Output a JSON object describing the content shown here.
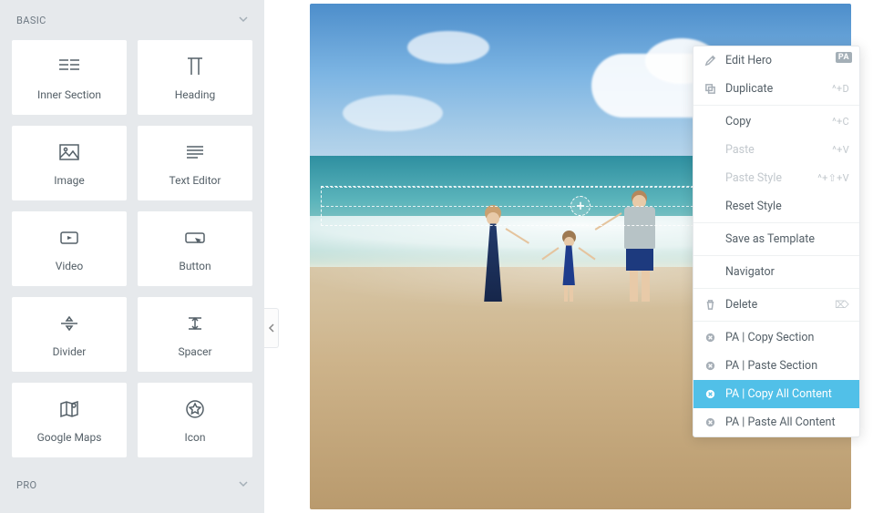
{
  "sidebar": {
    "sections": {
      "basic": {
        "title": "BASIC",
        "widgets": [
          {
            "label": "Inner Section",
            "icon": "inner-section"
          },
          {
            "label": "Heading",
            "icon": "heading"
          },
          {
            "label": "Image",
            "icon": "image"
          },
          {
            "label": "Text Editor",
            "icon": "text-editor"
          },
          {
            "label": "Video",
            "icon": "video"
          },
          {
            "label": "Button",
            "icon": "button"
          },
          {
            "label": "Divider",
            "icon": "divider"
          },
          {
            "label": "Spacer",
            "icon": "spacer"
          },
          {
            "label": "Google Maps",
            "icon": "google-maps"
          },
          {
            "label": "Icon",
            "icon": "icon"
          }
        ]
      },
      "pro": {
        "title": "PRO"
      }
    }
  },
  "canvas": {
    "hero_alt": "Family holding hands on a sunny beach with waves"
  },
  "context_menu": {
    "badge": "PA",
    "items": [
      {
        "key": "edit",
        "label": "Edit Hero",
        "icon": "pencil",
        "shortcut": "",
        "group": 1,
        "badge": true
      },
      {
        "key": "duplicate",
        "label": "Duplicate",
        "icon": "copy",
        "shortcut": "^+D",
        "group": 1
      },
      {
        "key": "copy",
        "label": "Copy",
        "icon": "",
        "shortcut": "^+C",
        "group": 2
      },
      {
        "key": "paste",
        "label": "Paste",
        "icon": "",
        "shortcut": "^+V",
        "group": 2,
        "disabled": true
      },
      {
        "key": "pastestyle",
        "label": "Paste Style",
        "icon": "",
        "shortcut": "^+⇧+V",
        "group": 2,
        "disabled": true
      },
      {
        "key": "resetstyle",
        "label": "Reset Style",
        "icon": "",
        "shortcut": "",
        "group": 2
      },
      {
        "key": "savetpl",
        "label": "Save as Template",
        "icon": "",
        "shortcut": "",
        "group": 3
      },
      {
        "key": "navigator",
        "label": "Navigator",
        "icon": "",
        "shortcut": "",
        "group": 4
      },
      {
        "key": "delete",
        "label": "Delete",
        "icon": "trash",
        "shortcut": "⌦",
        "group": 5
      },
      {
        "key": "pa_copy_s",
        "label": "PA | Copy Section",
        "icon": "pa",
        "shortcut": "",
        "group": 6
      },
      {
        "key": "pa_paste_s",
        "label": "PA | Paste Section",
        "icon": "pa",
        "shortcut": "",
        "group": 6
      },
      {
        "key": "pa_copy_a",
        "label": "PA | Copy All Content",
        "icon": "pa",
        "shortcut": "",
        "group": 6,
        "active": true
      },
      {
        "key": "pa_paste_a",
        "label": "PA | Paste All Content",
        "icon": "pa",
        "shortcut": "",
        "group": 6
      }
    ]
  },
  "colors": {
    "accent": "#51c0e8"
  }
}
